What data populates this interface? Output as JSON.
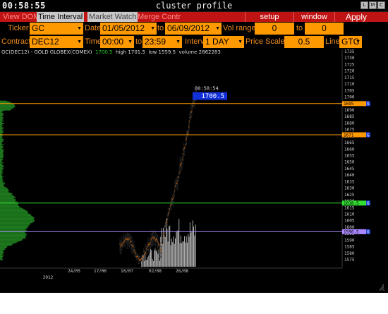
{
  "window": {
    "clock": "00:58:55",
    "title": "cluster profile",
    "buttons": [
      "L",
      "M",
      "C"
    ]
  },
  "tabs": [
    {
      "label": "View DOM",
      "active": false
    },
    {
      "label": "Time Interval",
      "active": true
    },
    {
      "label": "Market Watch",
      "active": false
    },
    {
      "label": "Merge Contr",
      "active": false
    }
  ],
  "toolbar": {
    "setup": "setup",
    "window": "window",
    "apply": "Apply"
  },
  "controls": {
    "ticker_label": "Ticker",
    "ticker": "GC",
    "date_label": "Date",
    "date_from": "01/05/2012",
    "to_label": "to",
    "date_to": "06/09/2012",
    "vol_label": "Vol range",
    "vol_from": "0",
    "vol_to_label": "to",
    "vol_to": "0",
    "contract_label": "Contract",
    "contract": "DEC12",
    "time_label": "Time",
    "time_from": "00:00",
    "time_to_label": "to",
    "time_to": "23:59",
    "interval_label": "Interval",
    "interval": "1 DAY",
    "price_scale_label": "Price Scale",
    "price_scale": "0.5",
    "line_label": "Line",
    "line": "GTC"
  },
  "info": {
    "symbol": "GC(DEC12) - GOLD GLOBEX(COMEX)",
    "last": "1700.5",
    "high": "high 1701.5",
    "low": "low 1559.5",
    "volume": "volume 2862283"
  },
  "cursor": {
    "time": "00:58:54",
    "price": "1700.5"
  },
  "chart_data": {
    "type": "candlestick",
    "price_axis": {
      "min": 1572,
      "max": 1737,
      "ticks": [
        1735,
        1730,
        1725,
        1720,
        1715,
        1710,
        1705,
        1700,
        1695,
        1690,
        1685,
        1680,
        1675,
        1670,
        1665,
        1660,
        1655,
        1650,
        1645,
        1640,
        1635,
        1630,
        1625,
        1620,
        1615,
        1610,
        1605,
        1600,
        1595,
        1590,
        1585,
        1580,
        1575
      ]
    },
    "x_axis": {
      "ticks": [
        "24/05",
        "17/06",
        "10/07",
        "02/08",
        "26/08"
      ],
      "year": "2012"
    },
    "levels": [
      {
        "price": 1695,
        "label": "1695",
        "color": "#ff9900"
      },
      {
        "price": 1671,
        "label": "1671",
        "color": "#ff9900"
      },
      {
        "price": 1618.5,
        "label": "1618.5",
        "color": "#33dd33"
      },
      {
        "price": 1596.5,
        "label": "1596.5",
        "color": "#aa88ff"
      }
    ],
    "level_tag": "G",
    "volume_profile": {
      "profile_min": 1575,
      "profile_max": 1697
    }
  },
  "colors": {
    "accent_red": "#c01414",
    "field_orange": "#ff9900",
    "label_orange": "#f08c1e",
    "up_green": "#28c828"
  }
}
